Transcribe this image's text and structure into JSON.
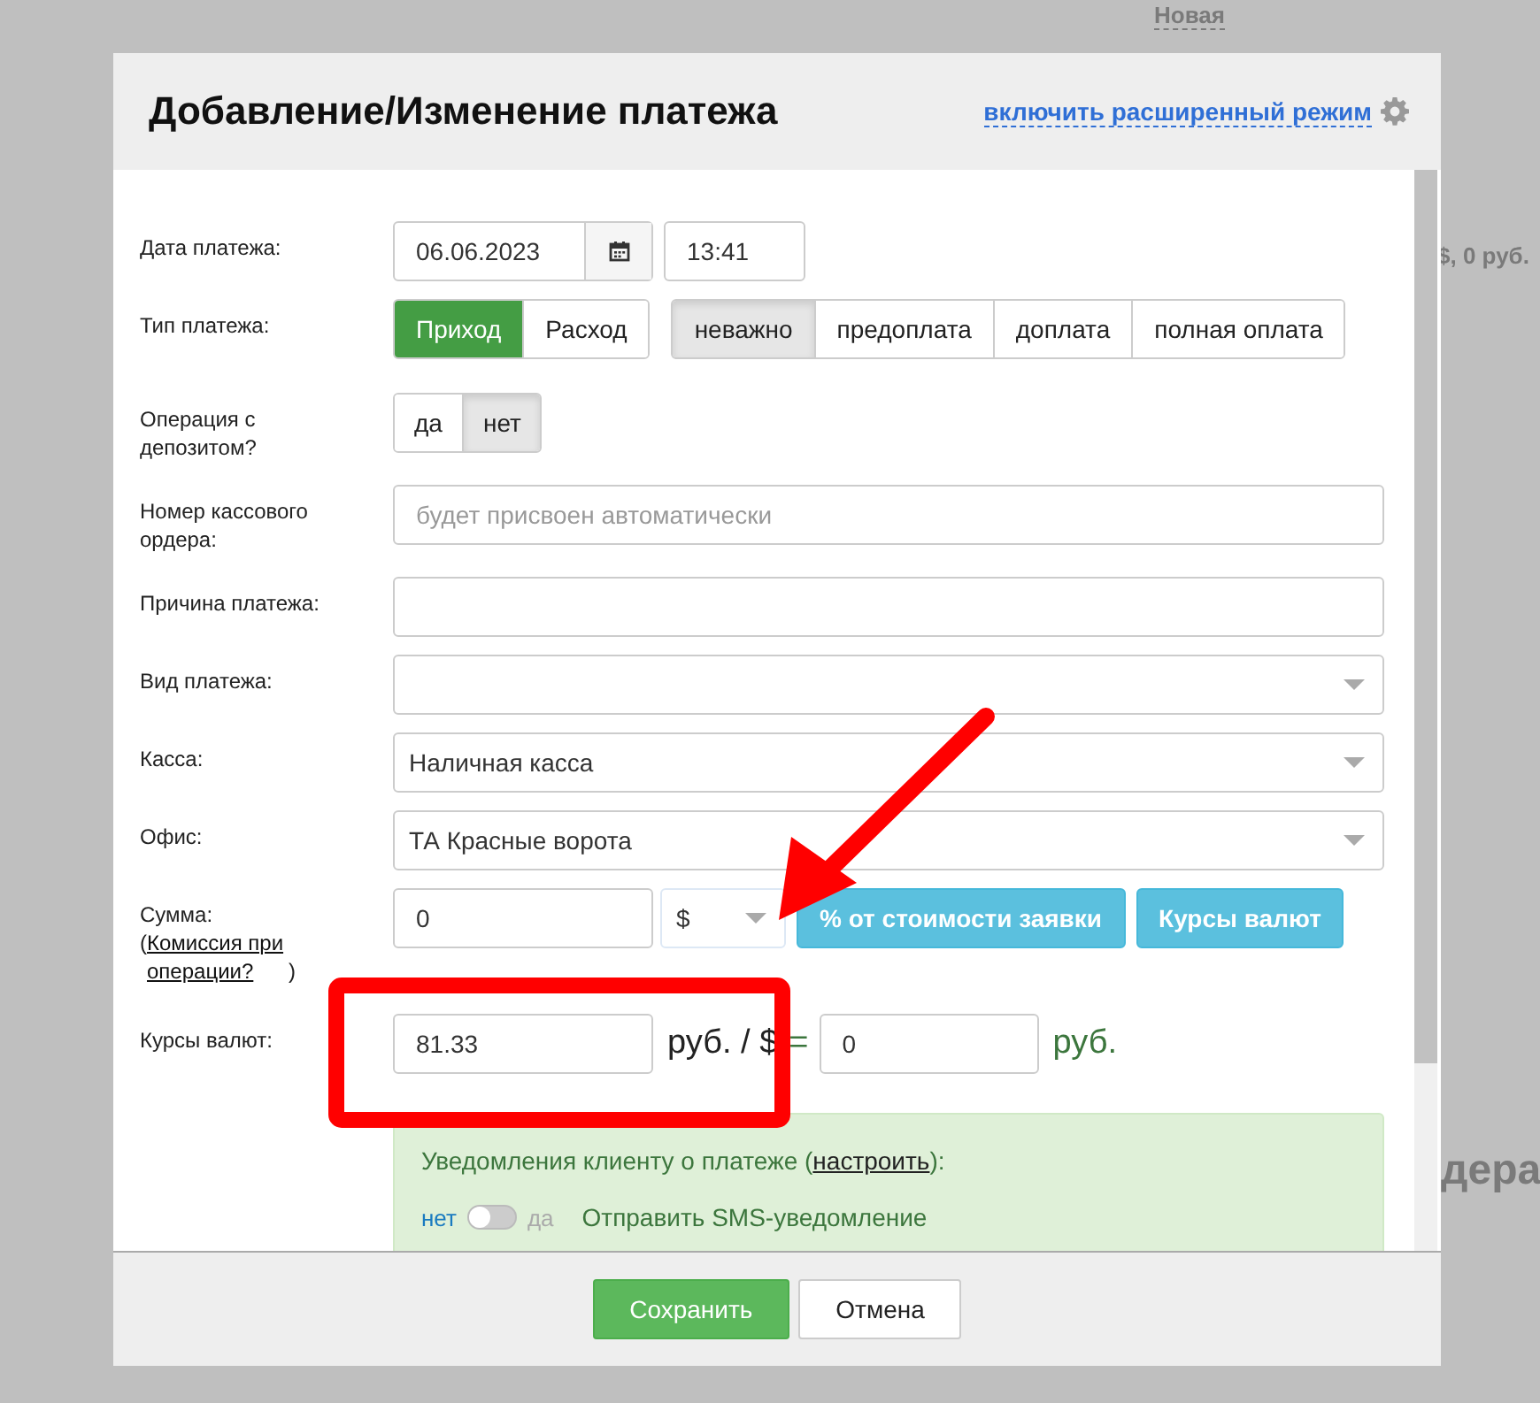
{
  "background": {
    "texts": [
      {
        "text": "Новая",
        "kind": "link"
      },
      {
        "text": "$, 0 руб.",
        "kind": "bold"
      },
      {
        "text": "дера",
        "kind": "heading"
      }
    ]
  },
  "dialog": {
    "title": "Добавление/Изменение платежа",
    "advanced_link": "включить расширенный режим"
  },
  "date": {
    "label": "Дата платежа:",
    "date": "06.06.2023",
    "time": "13:41"
  },
  "payment_type": {
    "label": "Тип платежа:",
    "directions": [
      {
        "label": "Приход",
        "selected": true
      },
      {
        "label": "Расход",
        "selected": false
      }
    ],
    "stages": [
      {
        "label": "неважно",
        "selected": true
      },
      {
        "label": "предоплата",
        "selected": false
      },
      {
        "label": "доплата",
        "selected": false
      },
      {
        "label": "полная оплата",
        "selected": false
      }
    ]
  },
  "deposit": {
    "label": "Операция с депозитом?",
    "options": [
      {
        "label": "да",
        "selected": false
      },
      {
        "label": "нет",
        "selected": true
      }
    ]
  },
  "order_number": {
    "label": "Номер кассового ордера:",
    "placeholder": "будет присвоен автоматически"
  },
  "reason": {
    "label": "Причина платежа:"
  },
  "kind": {
    "label": "Вид платежа:"
  },
  "cashbox": {
    "label": "Касса:",
    "value": "Наличная касса"
  },
  "office": {
    "label": "Офис:",
    "value": "ТА Красные ворота"
  },
  "amount": {
    "label": "Сумма:",
    "note_before": "(",
    "note_link": "Комиссия при операции?",
    "note_after": ")",
    "value": "0",
    "currency": "$",
    "buttons": [
      "% от стоимости заявки",
      "Курсы валют"
    ]
  },
  "rates": {
    "label": "Курсы валют:",
    "rate": "81.33",
    "unit": "руб. / $",
    "equals": "=",
    "result": "0",
    "result_unit": "руб."
  },
  "notifications": {
    "text_before": "Уведомления клиенту о платеже (",
    "link": "настроить",
    "text_after": "):",
    "toggle_off": "нет",
    "toggle_on": "да",
    "on": false,
    "sms_label": "Отправить SMS-уведомление"
  },
  "footer": {
    "save": "Сохранить",
    "cancel": "Отмена"
  }
}
